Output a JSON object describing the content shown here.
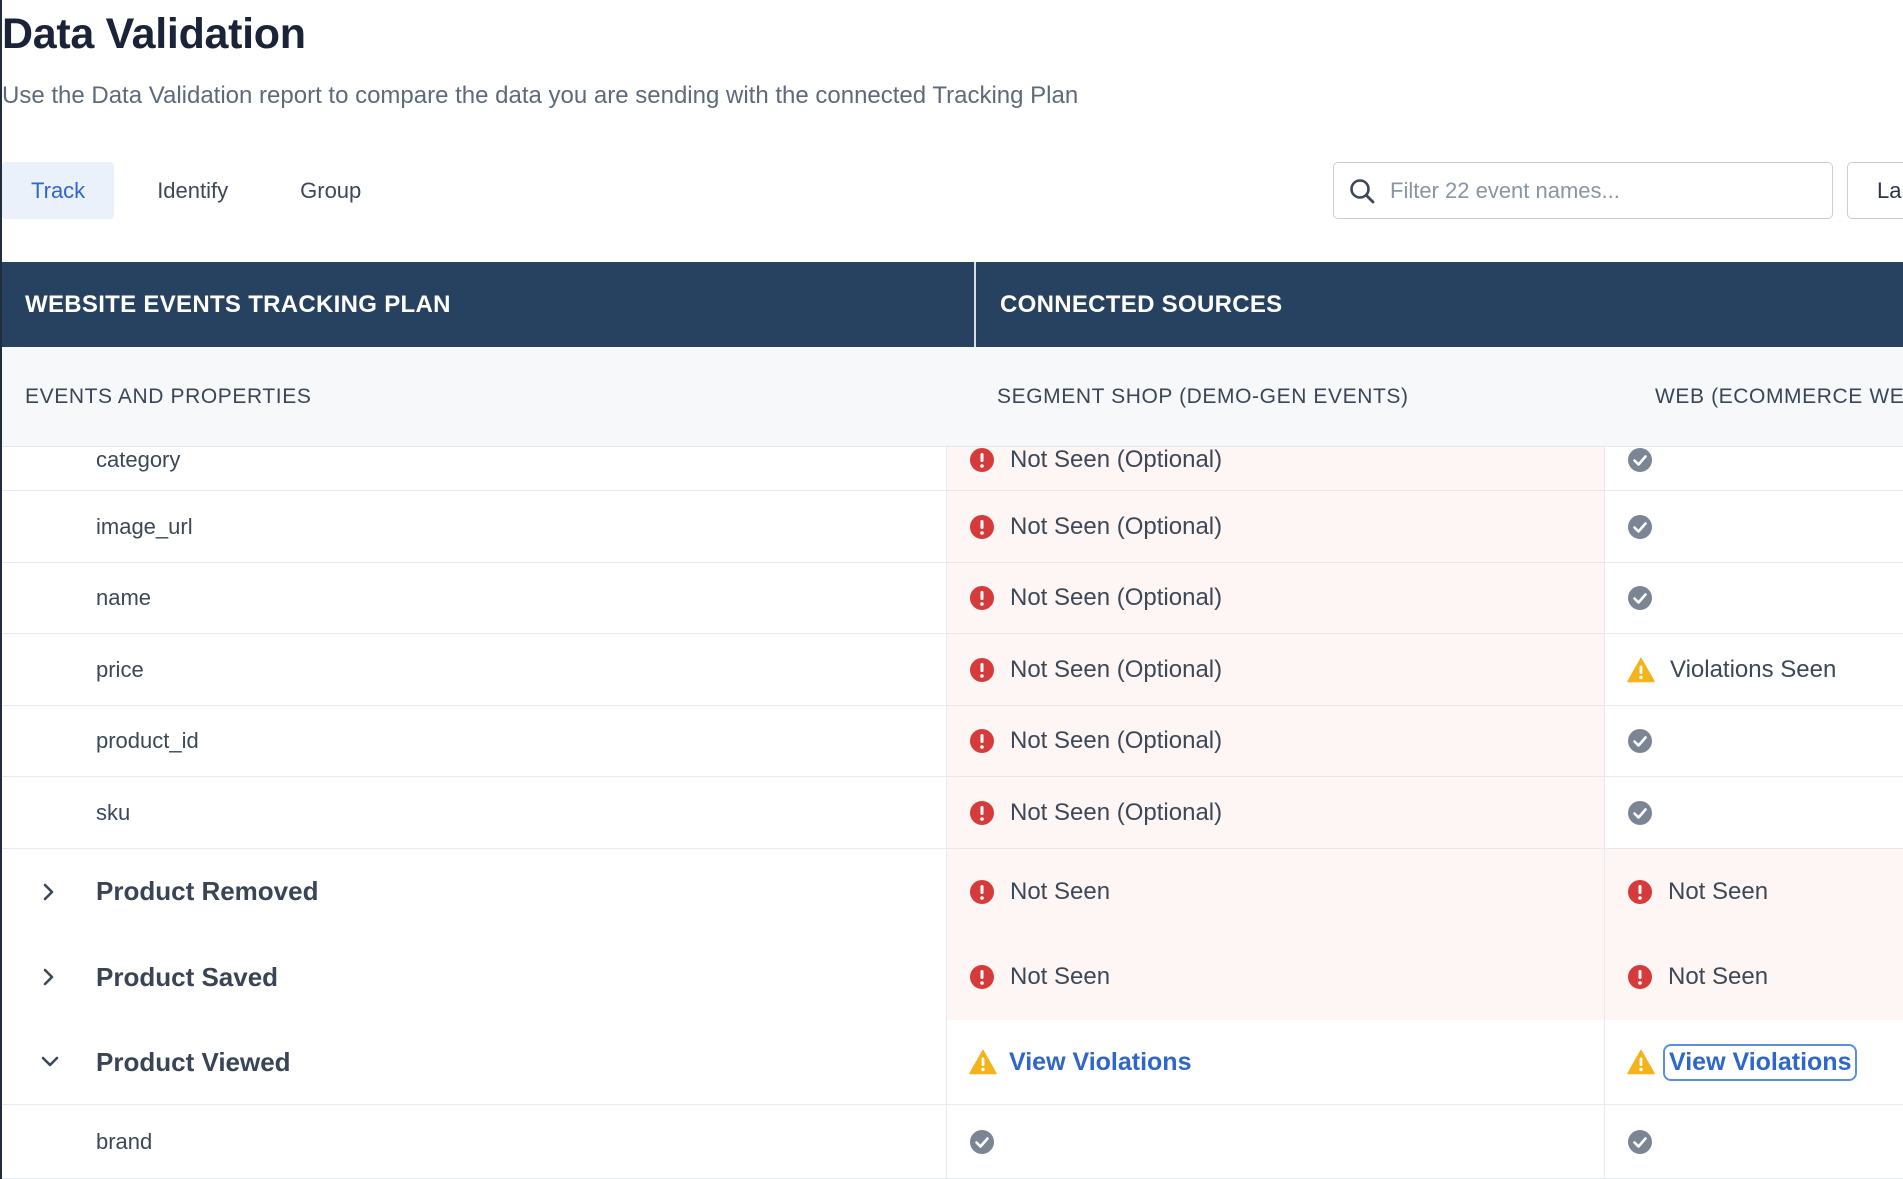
{
  "page": {
    "title": "Data Validation",
    "subtitle": "Use the Data Validation report to compare the data you are sending with the connected Tracking Plan"
  },
  "tabs": [
    {
      "label": "Track",
      "active": true
    },
    {
      "label": "Identify",
      "active": false
    },
    {
      "label": "Group",
      "active": false
    }
  ],
  "filter": {
    "placeholder": "Filter 22 event names...",
    "value": ""
  },
  "time_button": {
    "label": "La"
  },
  "table": {
    "plan_header": "WEBSITE EVENTS TRACKING PLAN",
    "sources_header": "CONNECTED SOURCES",
    "columns": {
      "events": "EVENTS AND PROPERTIES",
      "source_1": "SEGMENT SHOP (DEMO-GEN EVENTS)",
      "source_2": "WEB (ECOMMERCE WEB"
    },
    "rows": [
      {
        "name": "category",
        "kind": "property",
        "s1": {
          "status": "error",
          "text": "Not Seen (Optional)"
        },
        "s2": {
          "status": "ok",
          "text": ""
        }
      },
      {
        "name": "image_url",
        "kind": "property",
        "s1": {
          "status": "error",
          "text": "Not Seen (Optional)"
        },
        "s2": {
          "status": "ok",
          "text": ""
        }
      },
      {
        "name": "name",
        "kind": "property",
        "s1": {
          "status": "error",
          "text": "Not Seen (Optional)"
        },
        "s2": {
          "status": "ok",
          "text": ""
        }
      },
      {
        "name": "price",
        "kind": "property",
        "s1": {
          "status": "error",
          "text": "Not Seen (Optional)"
        },
        "s2": {
          "status": "warning",
          "text": "Violations Seen"
        }
      },
      {
        "name": "product_id",
        "kind": "property",
        "s1": {
          "status": "error",
          "text": "Not Seen (Optional)"
        },
        "s2": {
          "status": "ok",
          "text": ""
        }
      },
      {
        "name": "sku",
        "kind": "property",
        "s1": {
          "status": "error",
          "text": "Not Seen (Optional)"
        },
        "s2": {
          "status": "ok",
          "text": ""
        }
      },
      {
        "name": "Product Removed",
        "kind": "event",
        "expanded": false,
        "s1": {
          "status": "error",
          "text": "Not Seen"
        },
        "s2": {
          "status": "error",
          "text": "Not Seen"
        }
      },
      {
        "name": "Product Saved",
        "kind": "event",
        "expanded": false,
        "s1": {
          "status": "error",
          "text": "Not Seen"
        },
        "s2": {
          "status": "error",
          "text": "Not Seen"
        }
      },
      {
        "name": "Product Viewed",
        "kind": "event",
        "expanded": true,
        "s1": {
          "status": "link",
          "text": "View Violations"
        },
        "s2": {
          "status": "link",
          "text": "View Violations",
          "focused": true
        }
      },
      {
        "name": "brand",
        "kind": "property",
        "s1": {
          "status": "ok",
          "text": ""
        },
        "s2": {
          "status": "ok",
          "text": ""
        }
      }
    ]
  },
  "colors": {
    "header_bg": "#264260",
    "accent": "#2f66c9",
    "error": "#d63b3b",
    "warning": "#f2b31b",
    "ok": "#7b8594",
    "alert_bg": "#fef6f4"
  }
}
